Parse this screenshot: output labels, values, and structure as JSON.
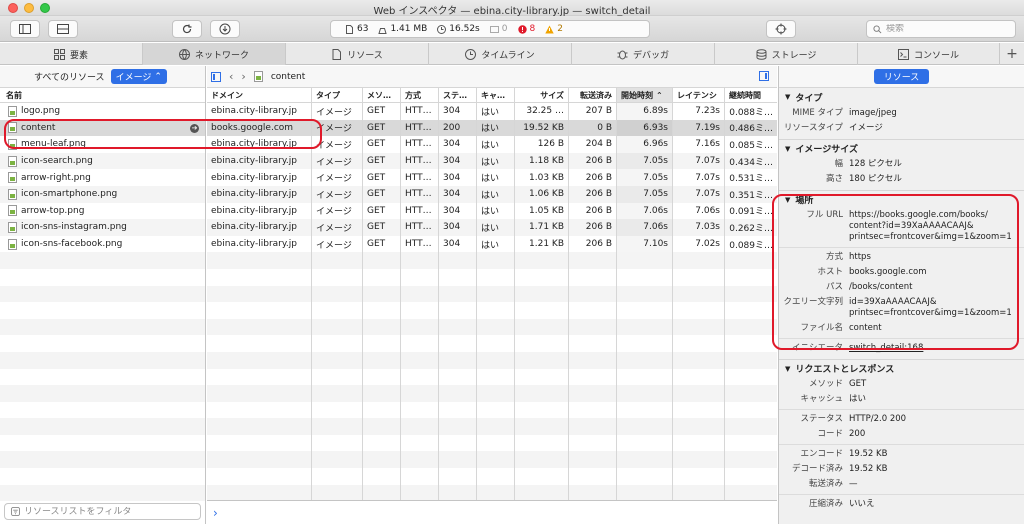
{
  "window_title": "Web インスペクタ — ebina.city-library.jp — switch_detail",
  "toolbar": {
    "stats": {
      "resources": "63",
      "size": "1.41 MB",
      "time": "16.52s",
      "logs": "0",
      "errors": "8",
      "warnings": "2"
    },
    "search_placeholder": "検索"
  },
  "tabs": [
    {
      "label": "要素",
      "icon": "elements-icon"
    },
    {
      "label": "ネットワーク",
      "icon": "network-icon"
    },
    {
      "label": "リソース",
      "icon": "resources-icon"
    },
    {
      "label": "タイムライン",
      "icon": "timeline-icon"
    },
    {
      "label": "デバッガ",
      "icon": "debugger-icon"
    },
    {
      "label": "ストレージ",
      "icon": "storage-icon"
    },
    {
      "label": "コンソール",
      "icon": "console-icon"
    }
  ],
  "sidebar": {
    "all_resources_label": "すべてのリソース",
    "filter_type": "イメージ",
    "name_header": "名前",
    "filter_placeholder": "リソースリストをフィルタ",
    "files": [
      "logo.png",
      "content",
      "menu-leaf.png",
      "icon-search.png",
      "arrow-right.png",
      "icon-smartphone.png",
      "arrow-top.png",
      "icon-sns-instagram.png",
      "icon-sns-facebook.png"
    ]
  },
  "main": {
    "breadcrumb": "content",
    "columns": [
      "ドメイン",
      "タイプ",
      "メソ…",
      "方式",
      "ステ…",
      "キャ…",
      "サイズ",
      "転送済み",
      "開始時刻",
      "レイテンシ",
      "継続時間"
    ],
    "rows": [
      [
        "ebina.city-library.jp",
        "イメージ",
        "GET",
        "HTT…",
        "304",
        "はい",
        "32.25 …",
        "207 B",
        "6.89s",
        "7.23s",
        "0.088ミ…"
      ],
      [
        "books.google.com",
        "イメージ",
        "GET",
        "HTT…",
        "200",
        "はい",
        "19.52 KB",
        "0 B",
        "6.93s",
        "7.19s",
        "0.486ミ…"
      ],
      [
        "ebina.city-library.jp",
        "イメージ",
        "GET",
        "HTT…",
        "304",
        "はい",
        "126 B",
        "204 B",
        "6.96s",
        "7.16s",
        "0.085ミ…"
      ],
      [
        "ebina.city-library.jp",
        "イメージ",
        "GET",
        "HTT…",
        "304",
        "はい",
        "1.18 KB",
        "206 B",
        "7.05s",
        "7.07s",
        "0.434ミ…"
      ],
      [
        "ebina.city-library.jp",
        "イメージ",
        "GET",
        "HTT…",
        "304",
        "はい",
        "1.03 KB",
        "206 B",
        "7.05s",
        "7.07s",
        "0.531ミ…"
      ],
      [
        "ebina.city-library.jp",
        "イメージ",
        "GET",
        "HTT…",
        "304",
        "はい",
        "1.06 KB",
        "206 B",
        "7.05s",
        "7.07s",
        "0.351ミ…"
      ],
      [
        "ebina.city-library.jp",
        "イメージ",
        "GET",
        "HTT…",
        "304",
        "はい",
        "1.05 KB",
        "206 B",
        "7.06s",
        "7.06s",
        "0.091ミ…"
      ],
      [
        "ebina.city-library.jp",
        "イメージ",
        "GET",
        "HTT…",
        "304",
        "はい",
        "1.71 KB",
        "206 B",
        "7.06s",
        "7.03s",
        "0.262ミ…"
      ],
      [
        "ebina.city-library.jp",
        "イメージ",
        "GET",
        "HTT…",
        "304",
        "はい",
        "1.21 KB",
        "206 B",
        "7.10s",
        "7.02s",
        "0.089ミ…"
      ]
    ]
  },
  "detail": {
    "resource_button": "リソース",
    "type_section": "タイプ",
    "mime_label": "MIME タイプ",
    "mime_value": "image/jpeg",
    "rtype_label": "リソースタイプ",
    "rtype_value": "イメージ",
    "size_section": "イメージサイズ",
    "width_label": "幅",
    "width_value": "128 ピクセル",
    "height_label": "高さ",
    "height_value": "180 ピクセル",
    "location_section": "場所",
    "fullurl_label": "フル URL",
    "fullurl_value": "https://books.google.com/books/\ncontent?id=39XaAAAACAAJ&\nprintsec=frontcover&img=1&zoom=1",
    "scheme_label": "方式",
    "scheme_value": "https",
    "host_label": "ホスト",
    "host_value": "books.google.com",
    "path_label": "パス",
    "path_value": "/books/content",
    "query_label": "クエリー文字列",
    "query_value": "id=39XaAAAACAAJ&\nprintsec=frontcover&img=1&zoom=1",
    "filename_label": "ファイル名",
    "filename_value": "content",
    "initiator_label": "イニシエータ",
    "initiator_value": "switch_detail:168",
    "reqres_section": "リクエストとレスポンス",
    "method_label": "メソッド",
    "method_value": "GET",
    "cache_label": "キャッシュ",
    "cache_value": "はい",
    "status_label": "ステータス",
    "status_value": "HTTP/2.0 200",
    "code_label": "コード",
    "code_value": "200",
    "encoded_label": "エンコード",
    "encoded_value": "19.52 KB",
    "decoded_label": "デコード済み",
    "decoded_value": "19.52 KB",
    "transferred_label": "転送済み",
    "transferred_value": "—",
    "compressed_label": "圧縮済み",
    "compressed_value": "いいえ"
  },
  "colors": {
    "accent": "#2f6fe6",
    "highlight": "#e0192a",
    "error": "#e0192a",
    "warning": "#f0a400"
  }
}
